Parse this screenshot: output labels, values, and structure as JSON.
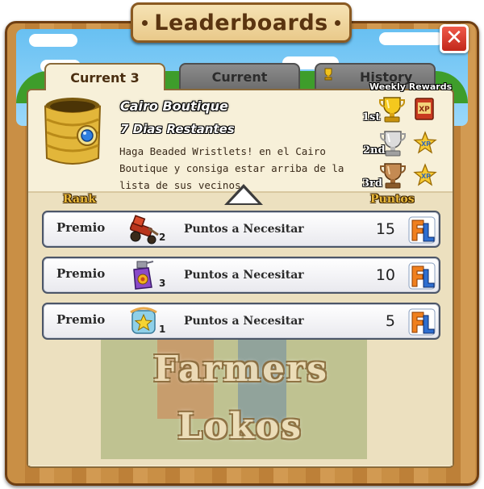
{
  "window": {
    "title": "Leaderboards",
    "close_glyph": "✕"
  },
  "tabs": [
    {
      "label": "Current 3",
      "active": true
    },
    {
      "label": "Current",
      "active": false
    },
    {
      "label": "History",
      "active": false,
      "icon": "trophy-icon"
    }
  ],
  "quest": {
    "name": "Cairo Boutique",
    "days_left": "7 Dias Restantes",
    "description": "Haga Beaded Wristlets! en el Cairo Boutique y consiga estar arriba de la lista de sus vecinos.",
    "icon": "beaded-bracelet-icon"
  },
  "weekly_rewards": {
    "heading": "Weekly Rewards",
    "ranks": [
      {
        "label": "1st",
        "trophy": "gold-trophy-icon",
        "reward": "xp-book-icon"
      },
      {
        "label": "2nd",
        "trophy": "silver-trophy-icon",
        "reward": "xp-star-icon"
      },
      {
        "label": "3rd",
        "trophy": "bronze-trophy-icon",
        "reward": "xp-star-icon"
      }
    ],
    "xp_label": "XP"
  },
  "table": {
    "col_rank": "Rank",
    "col_points": "Puntos",
    "rows": [
      {
        "prize_label": "Premio",
        "item_icon": "tractor-icon",
        "qty": "2",
        "need_label": "Puntos a Necesitar",
        "points": "15"
      },
      {
        "prize_label": "Premio",
        "item_icon": "spray-bottle-icon",
        "qty": "3",
        "need_label": "Puntos a Necesitar",
        "points": "10"
      },
      {
        "prize_label": "Premio",
        "item_icon": "star-badge-icon",
        "qty": "1",
        "need_label": "Puntos a Necesitar",
        "points": "5"
      }
    ]
  },
  "watermark": {
    "line1": "Farmers",
    "line2": "Lokos"
  },
  "colors": {
    "frame_wood": "#c98f45",
    "panel_cream": "#f7f0d9",
    "close_red": "#d8382a",
    "fl_orange": "#f0801e",
    "fl_blue": "#2f6fd0"
  }
}
